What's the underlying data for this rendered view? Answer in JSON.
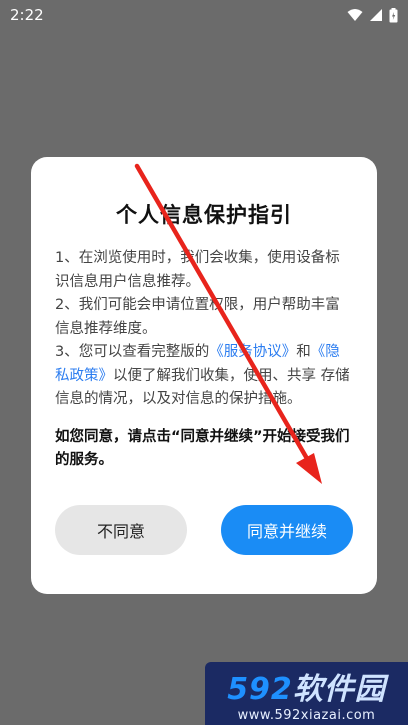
{
  "status_bar": {
    "time": "2:22",
    "icons": [
      "wifi-icon",
      "signal-icon",
      "battery-icon"
    ]
  },
  "dialog": {
    "title": "个人信息保护指引",
    "item1": "1、在浏览使用时，我们会收集，使用设备标识信息用户信息推荐。",
    "item2": "2、我们可能会申请位置权限，用户帮助丰富信息推荐维度。",
    "item3_prefix": "3、您可以查看完整版的",
    "service_link": "《服务协议》",
    "item3_and": "和",
    "privacy_link": "《隐私政策》",
    "item3_suffix": "以便了解我们收集，使用、共享 存储信息的情况，以及对信息的保护措施。",
    "consent_text": "如您同意，请点击“同意并继续”开始接受我们的服务。",
    "decline_label": "不同意",
    "agree_label": "同意并继续"
  },
  "colors": {
    "overlay": "#6b6b6b",
    "link": "#2c7df0",
    "agree_button": "#1a8cf5",
    "arrow": "#e8241c"
  },
  "watermark": {
    "logo_num": "592",
    "logo_text": "软件园",
    "url": "www.592xiazai.com"
  }
}
